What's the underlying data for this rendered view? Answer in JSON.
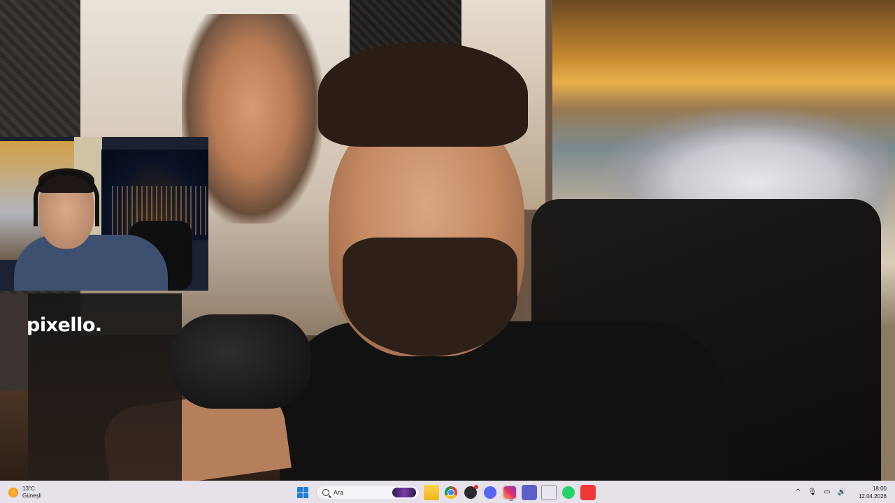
{
  "wallpaper": {
    "overlay_logo": "pixello."
  },
  "taskbar": {
    "weather": {
      "temperature": "13°C",
      "condition": "Güneşli",
      "icon": "sun-icon"
    },
    "search": {
      "placeholder": "Ara"
    },
    "apps": [
      {
        "name": "windows-start",
        "icon": "windows-logo-icon"
      },
      {
        "name": "file-explorer",
        "icon": "folder-icon"
      },
      {
        "name": "chrome",
        "icon": "chrome-icon"
      },
      {
        "name": "obs",
        "icon": "obs-icon"
      },
      {
        "name": "discord",
        "icon": "discord-icon"
      },
      {
        "name": "instagram",
        "icon": "instagram-icon"
      },
      {
        "name": "teams",
        "icon": "teams-icon"
      },
      {
        "name": "calculator",
        "icon": "calculator-icon"
      },
      {
        "name": "whatsapp",
        "icon": "whatsapp-icon"
      },
      {
        "name": "vivaldi",
        "icon": "vivaldi-icon"
      }
    ],
    "tray": {
      "chevron": "^",
      "mic": "🎙",
      "network": "▭",
      "volume": "🔊"
    },
    "clock": {
      "time": "18:00",
      "date": "12.04.2026"
    }
  },
  "colors": {
    "taskbar_bg": "#e7e2ea",
    "start_accent": "#1e7fd8",
    "weather_sun": "#f29a16"
  }
}
